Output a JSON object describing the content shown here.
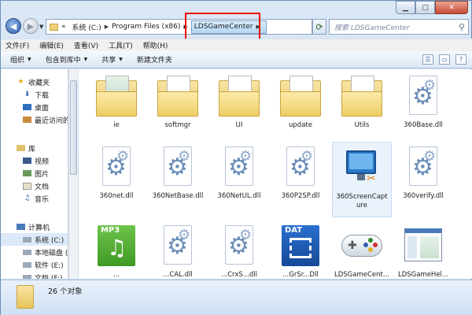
{
  "breadcrumb": {
    "prefix": "«",
    "items": [
      "系统 (C:)",
      "Program Files (x86)",
      "LDSGameCenter"
    ]
  },
  "search": {
    "placeholder": "搜索 LDSGameCenter"
  },
  "menu": [
    "文件(F)",
    "编辑(E)",
    "查看(V)",
    "工具(T)",
    "帮助(H)"
  ],
  "commands": [
    "组织",
    "包含到库中",
    "共享",
    "新建文件夹"
  ],
  "nav": {
    "favorites": "收藏夹",
    "downloads": "下载",
    "desktop": "桌面",
    "recent": "最近访问的",
    "library": "库",
    "videos": "视频",
    "pictures": "图片",
    "documents": "文档",
    "music": "音乐",
    "computer": "计算机",
    "drive_c": "系统 (C:)",
    "drive_d": "本地磁盘 (",
    "drive_e": "软件 (E:)",
    "drive_f": "文档 (F:)"
  },
  "files": [
    {
      "name": "ie",
      "type": "folder"
    },
    {
      "name": "softmgr",
      "type": "folder"
    },
    {
      "name": "UI",
      "type": "folder"
    },
    {
      "name": "update",
      "type": "folder"
    },
    {
      "name": "Utils",
      "type": "folder"
    },
    {
      "name": "360Base.dll",
      "type": "dll"
    },
    {
      "name": "360net.dll",
      "type": "dll"
    },
    {
      "name": "360NetBase.dll",
      "type": "dll"
    },
    {
      "name": "360NetUL.dll",
      "type": "dll"
    },
    {
      "name": "360P2SP.dll",
      "type": "dll"
    },
    {
      "name": "360ScreenCapture",
      "type": "exe-screen"
    },
    {
      "name": "360verify.dll",
      "type": "dll"
    },
    {
      "name": "...",
      "type": "mp3"
    },
    {
      "name": "...CAL.dll",
      "type": "dll"
    },
    {
      "name": "...CrxS...dll",
      "type": "dll"
    },
    {
      "name": "...GrSr...Dll",
      "type": "dat"
    },
    {
      "name": "LDSGameCent...",
      "type": "gamepad"
    },
    {
      "name": "LDSGameHel...",
      "type": "window"
    }
  ],
  "status": {
    "count": "26 个对象"
  }
}
